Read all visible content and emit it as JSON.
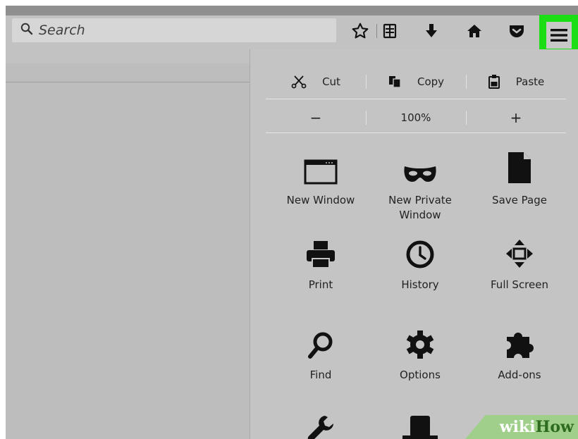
{
  "browser": {
    "search": {
      "placeholder": "Search",
      "icon": "magnifier-icon"
    },
    "toolbar_icons": [
      "star-icon",
      "reading-list-icon",
      "download-icon",
      "home-icon",
      "pocket-icon"
    ],
    "menu_button": {
      "icon": "hamburger-icon",
      "highlight_color": "#1bdf14"
    }
  },
  "menu": {
    "edit": {
      "cut": {
        "label": "Cut",
        "icon": "scissors-icon"
      },
      "copy": {
        "label": "Copy",
        "icon": "copy-icon"
      },
      "paste": {
        "label": "Paste",
        "icon": "paste-icon"
      }
    },
    "zoom": {
      "minus": "−",
      "level": "100%",
      "plus": "+"
    },
    "items": [
      {
        "label": "New Window",
        "icon": "window-icon"
      },
      {
        "label": "New Private\nWindow",
        "icon": "mask-icon"
      },
      {
        "label": "Save Page",
        "icon": "page-icon"
      },
      {
        "label": "Print",
        "icon": "printer-icon"
      },
      {
        "label": "History",
        "icon": "clock-icon"
      },
      {
        "label": "Full Screen",
        "icon": "fullscreen-icon"
      },
      {
        "label": "Find",
        "icon": "magnifier-icon"
      },
      {
        "label": "Options",
        "icon": "gear-icon"
      },
      {
        "label": "Add-ons",
        "icon": "puzzle-icon"
      },
      {
        "label": "",
        "icon": "wrench-icon"
      },
      {
        "label": "",
        "icon": "hat-icon"
      }
    ]
  },
  "watermark": {
    "part1": "wiki",
    "part2": "How"
  }
}
